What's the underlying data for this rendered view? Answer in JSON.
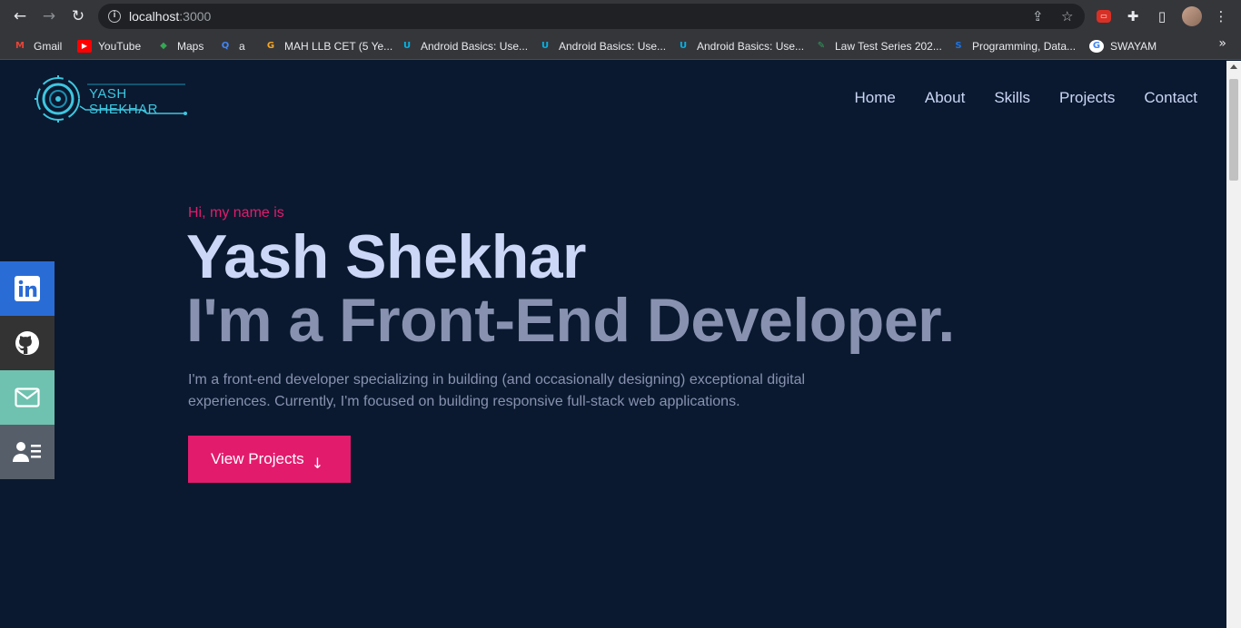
{
  "browser": {
    "url_host": "localhost",
    "url_port": ":3000",
    "bookmarks": [
      {
        "label": "Gmail",
        "icon": "gmail-icon",
        "color": "#ea4335",
        "glyph": "M"
      },
      {
        "label": "YouTube",
        "icon": "youtube-icon",
        "color": "#ff0000",
        "glyph": "▶"
      },
      {
        "label": "Maps",
        "icon": "maps-icon",
        "color": "#34a853",
        "glyph": "◆"
      },
      {
        "label": "a",
        "icon": "lens-icon",
        "color": "#4285f4",
        "glyph": "Q"
      },
      {
        "label": "MAH LLB CET (5 Ye...",
        "icon": "gradeup-icon",
        "color": "#f5a623",
        "glyph": "G"
      },
      {
        "label": "Android Basics: Use...",
        "icon": "udacity-icon",
        "color": "#02b3e4",
        "glyph": "U"
      },
      {
        "label": "Android Basics: Use...",
        "icon": "udacity-icon",
        "color": "#02b3e4",
        "glyph": "U"
      },
      {
        "label": "Android Basics: Use...",
        "icon": "udacity-icon",
        "color": "#02b3e4",
        "glyph": "U"
      },
      {
        "label": "Law Test Series 202...",
        "icon": "law-icon",
        "color": "#2e9e5b",
        "glyph": "✎"
      },
      {
        "label": "Programming, Data...",
        "icon": "programming-icon",
        "color": "#1a73e8",
        "glyph": "S"
      },
      {
        "label": "SWAYAM",
        "icon": "google-icon",
        "color": "#ffffff",
        "glyph": "G"
      }
    ]
  },
  "site": {
    "logo_text": "YASH SHEKHAR",
    "nav": [
      "Home",
      "About",
      "Skills",
      "Projects",
      "Contact"
    ],
    "greeting": "Hi, my name is",
    "name": "Yash Shekhar",
    "role": "I'm a Front-End Developer.",
    "intro": "I'm a front-end developer specializing in building (and occasionally designing) exceptional digital experiences. Currently, I'm focused on building responsive full-stack web applications.",
    "cta_label": "View Projects",
    "social": [
      {
        "icon": "linkedin-icon",
        "color": "#0e76a8"
      },
      {
        "icon": "github-icon",
        "color": "#333333"
      },
      {
        "icon": "mail-icon",
        "color": "#6fc2b0"
      },
      {
        "icon": "resume-icon",
        "color": "#565f69"
      }
    ]
  },
  "colors": {
    "background": "#0a192f",
    "accent": "#e31b6d",
    "heading": "#ccd6f6",
    "muted": "#8892b0",
    "logo": "#3ec6e0"
  }
}
